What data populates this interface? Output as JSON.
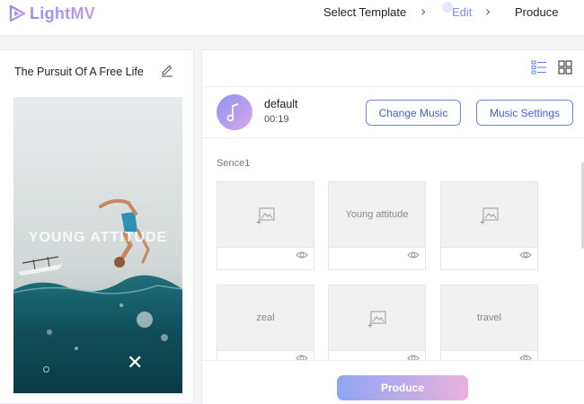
{
  "app": {
    "name": "LightMV"
  },
  "steps": [
    {
      "label": "Select Template",
      "state": "done"
    },
    {
      "label": "Edit",
      "state": "active"
    },
    {
      "label": "Produce",
      "state": "pending"
    }
  ],
  "project": {
    "title": "The Pursuit Of A Free Life"
  },
  "preview": {
    "overlay_text": "YOUNG ATTITUDE"
  },
  "music": {
    "title": "default",
    "duration": "00:19",
    "change_label": "Change Music",
    "settings_label": "Music Settings"
  },
  "scene": {
    "label": "Sence1",
    "tiles": [
      {
        "type": "image"
      },
      {
        "type": "text",
        "text": "Young attitude"
      },
      {
        "type": "image"
      },
      {
        "type": "text",
        "text": "zeal"
      },
      {
        "type": "image"
      },
      {
        "type": "text",
        "text": "travel"
      }
    ]
  },
  "produce_label": "Produce",
  "icons": {
    "logo": "play-triangle-logo-icon",
    "step_separator": "chevron-right-icon",
    "edit_title": "pencil-icon",
    "list_view": "list-view-icon",
    "grid_view": "grid-view-icon",
    "music": "music-note-icon",
    "image_placeholder": "image-placeholder-icon",
    "preview": "eye-icon",
    "close": "close-icon"
  },
  "colors": {
    "accent": "#7c8cf3",
    "button_border": "#6e86ea",
    "button_text": "#3f62d8",
    "produce_gradient_start": "#8ea6f4",
    "produce_gradient_end": "#eab1dc"
  }
}
